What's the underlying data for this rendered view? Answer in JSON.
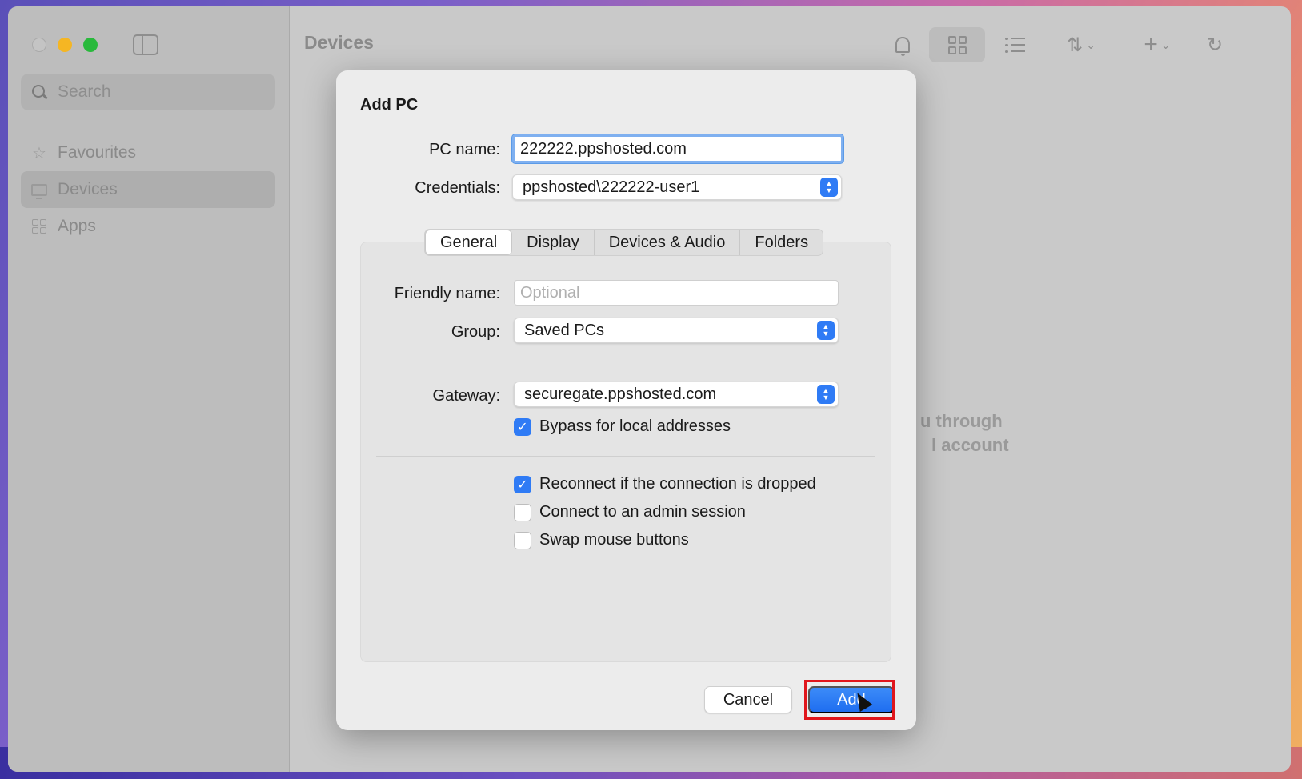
{
  "window": {
    "title": "Devices"
  },
  "sidebar": {
    "search_placeholder": "Search",
    "items": [
      {
        "label": "Favourites",
        "icon": "star-icon"
      },
      {
        "label": "Devices",
        "icon": "monitor-icon",
        "active": true
      },
      {
        "label": "Apps",
        "icon": "apps-icon"
      }
    ]
  },
  "background_text": {
    "line1": "u through",
    "line2": "l account"
  },
  "dialog": {
    "title": "Add PC",
    "pc_name_label": "PC name:",
    "pc_name_value": "222222.ppshosted.com",
    "credentials_label": "Credentials:",
    "credentials_value": "ppshosted\\222222-user1",
    "tabs": [
      "General",
      "Display",
      "Devices & Audio",
      "Folders"
    ],
    "active_tab": "General",
    "friendly_name_label": "Friendly name:",
    "friendly_name_placeholder": "Optional",
    "group_label": "Group:",
    "group_value": "Saved PCs",
    "gateway_label": "Gateway:",
    "gateway_value": "securegate.ppshosted.com",
    "checkboxes": [
      {
        "label": "Bypass for local addresses",
        "checked": true
      },
      {
        "label": "Reconnect if the connection is dropped",
        "checked": true
      },
      {
        "label": "Connect to an admin session",
        "checked": false
      },
      {
        "label": "Swap mouse buttons",
        "checked": false
      }
    ],
    "cancel_label": "Cancel",
    "add_label": "Add"
  },
  "colors": {
    "accent": "#2f7bf5",
    "highlight": "#e0161c"
  }
}
